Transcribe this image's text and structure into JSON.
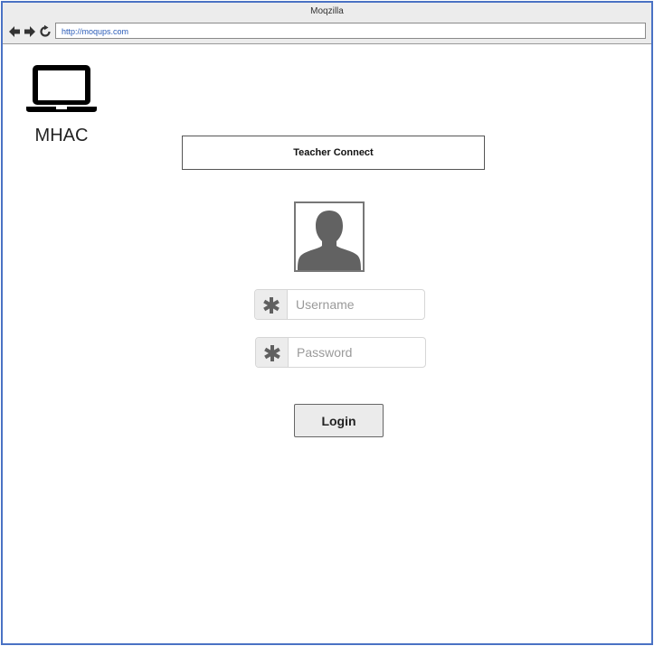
{
  "window": {
    "title": "Moqzilla",
    "url": "http://moqups.com"
  },
  "nav": {
    "back_icon": "arrow-left-icon",
    "forward_icon": "arrow-right-icon",
    "reload_icon": "reload-icon"
  },
  "brand": {
    "icon": "laptop-icon",
    "name": "MHAC"
  },
  "header": {
    "title": "Teacher Connect"
  },
  "login": {
    "avatar_icon": "user-silhouette-icon",
    "username": {
      "placeholder": "Username",
      "value": "",
      "icon": "asterisk-icon"
    },
    "password": {
      "placeholder": "Password",
      "value": "",
      "icon": "asterisk-icon"
    },
    "submit_label": "Login"
  },
  "colors": {
    "window_border": "#4a72c4",
    "chrome_bg": "#ececec",
    "url_text": "#2a5cb8",
    "icon_gray": "#606060"
  }
}
